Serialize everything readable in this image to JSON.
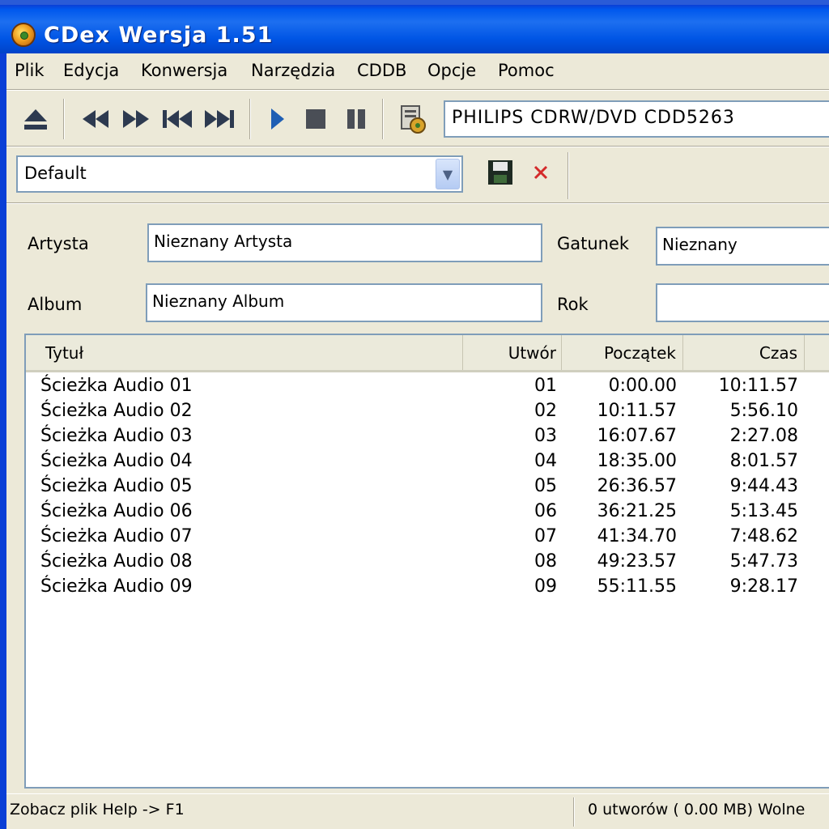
{
  "window": {
    "title": "CDex Wersja 1.51"
  },
  "menu": [
    "Plik",
    "Edycja",
    "Konwersja",
    "Narzędzia",
    "CDDB",
    "Opcje",
    "Pomoc"
  ],
  "toolbar": {
    "icons": [
      "eject-icon",
      "rewind-icon",
      "fast-forward-icon",
      "previous-track-icon",
      "next-track-icon",
      "play-icon",
      "stop-icon",
      "pause-icon",
      "cd-info-icon"
    ],
    "drive": "PHILIPS CDRW/DVD CDD5263"
  },
  "profile": {
    "selected": "Default",
    "icons": [
      "save-icon",
      "delete-icon"
    ]
  },
  "info": {
    "artist_label": "Artysta",
    "artist_value": "Nieznany Artysta",
    "album_label": "Album",
    "album_value": "Nieznany Album",
    "genre_label": "Gatunek",
    "genre_value": "Nieznany",
    "year_label": "Rok",
    "year_value": ""
  },
  "tracks": {
    "columns": [
      "Tytuł",
      "Utwór",
      "Początek",
      "Czas"
    ],
    "rows": [
      {
        "title": "Ścieżka Audio 01",
        "track": "01",
        "start": "0:00.00",
        "time": "10:11.57"
      },
      {
        "title": "Ścieżka Audio 02",
        "track": "02",
        "start": "10:11.57",
        "time": "5:56.10"
      },
      {
        "title": "Ścieżka Audio 03",
        "track": "03",
        "start": "16:07.67",
        "time": "2:27.08"
      },
      {
        "title": "Ścieżka Audio 04",
        "track": "04",
        "start": "18:35.00",
        "time": "8:01.57"
      },
      {
        "title": "Ścieżka Audio 05",
        "track": "05",
        "start": "26:36.57",
        "time": "9:44.43"
      },
      {
        "title": "Ścieżka Audio 06",
        "track": "06",
        "start": "36:21.25",
        "time": "5:13.45"
      },
      {
        "title": "Ścieżka Audio 07",
        "track": "07",
        "start": "41:34.70",
        "time": "7:48.62"
      },
      {
        "title": "Ścieżka Audio 08",
        "track": "08",
        "start": "49:23.57",
        "time": "5:47.73"
      },
      {
        "title": "Ścieżka Audio 09",
        "track": "09",
        "start": "55:11.55",
        "time": "9:28.17"
      }
    ]
  },
  "status": {
    "help": "Zobacz plik Help -> F1",
    "summary": "0 utworów ( 0.00 MB) Wolne"
  },
  "colors": {
    "titlebar": "#0058ee",
    "face": "#ece9d8",
    "field_border": "#7f9db9"
  }
}
